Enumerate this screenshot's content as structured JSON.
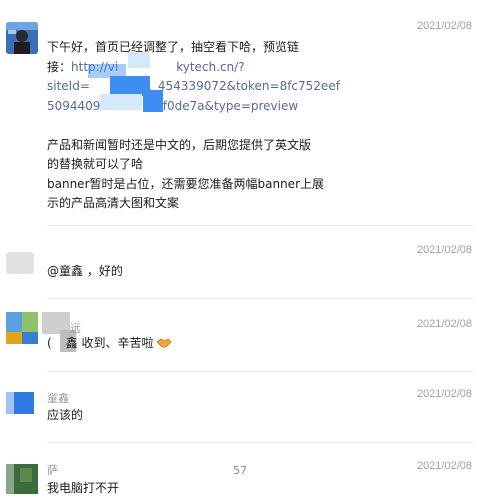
{
  "colors": {
    "link": "#576b95",
    "timestamp": "#a3a3a3",
    "divider": "#ececec"
  },
  "messages": [
    {
      "sender": "",
      "time": "2021/02/08",
      "lines": {
        "l1": "下午好，首页已经调整了，抽空看下哈，预览链",
        "l2_prefix": "接：",
        "l2_link": "http://vi",
        "l2_link_b": "kytech.cn/?",
        "l3_link_a": "siteId=",
        "l3_link_b": "454339072&token=8fc752eef",
        "l4_link_a": "5094409",
        "l4_link_b": "af0de7a&type=preview",
        "l5": "产品和新闻暂时还是中文的，后期您提供了英文版",
        "l6": "的替换就可以了哈",
        "l7": "banner暂时是占位，还需要您准备两幅banner上展",
        "l8": "示的产品高清大图和文案"
      }
    },
    {
      "sender": "",
      "time": "2021/02/08",
      "text": "@童鑫 ，好的"
    },
    {
      "sender": "远",
      "time": "2021/02/08",
      "text_prefix": "(",
      "text": "鑫 收到、辛苦啦",
      "emoji": "handshake-emoji"
    },
    {
      "sender": "童鑫",
      "time": "2021/02/08",
      "text": "应该的"
    },
    {
      "sender": "萨",
      "time": "2021/02/08",
      "text": "我电脑打不开",
      "stray": "57"
    }
  ]
}
